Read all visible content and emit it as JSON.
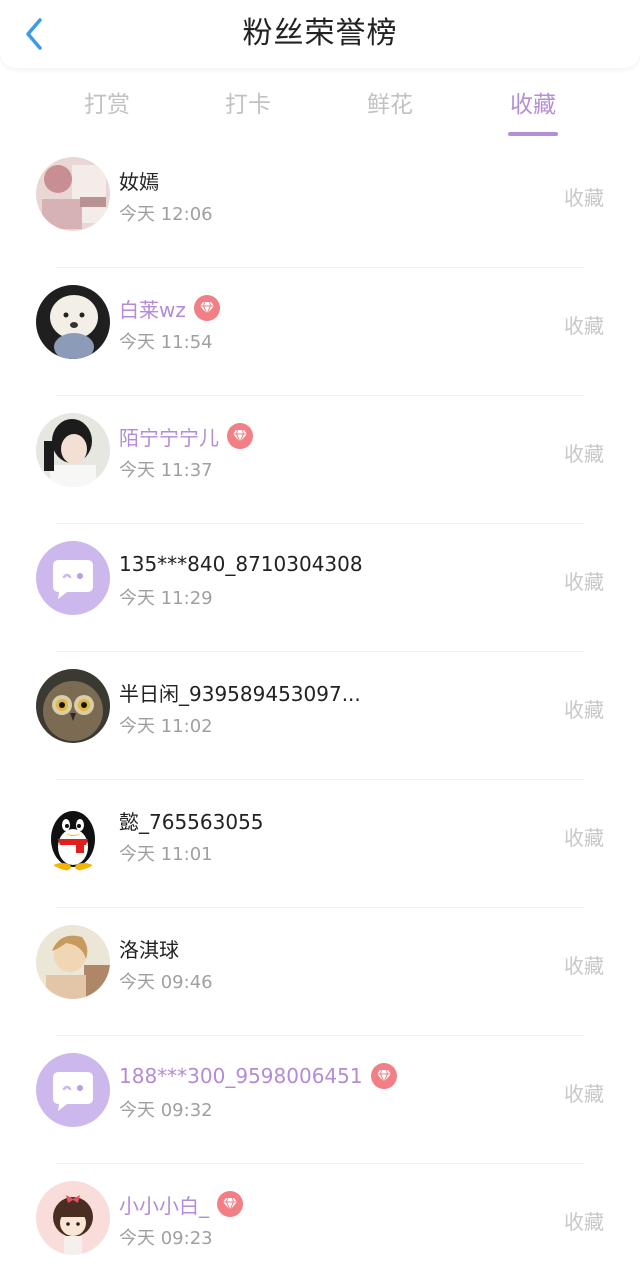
{
  "header": {
    "title": "粉丝荣誉榜",
    "back_icon": "chevron-left-icon"
  },
  "tabs": [
    {
      "label": "打赏",
      "active": false
    },
    {
      "label": "打卡",
      "active": false
    },
    {
      "label": "鲜花",
      "active": false
    },
    {
      "label": "收藏",
      "active": true
    }
  ],
  "colors": {
    "accent": "#b58fd6",
    "vip_name": "#b38bd6",
    "vip_badge": "#f17f85",
    "back_icon": "#3a9bea"
  },
  "fans": [
    {
      "name": "奻嫣",
      "time": "今天 12:06",
      "action": "收藏",
      "vip": false,
      "avatar": "photo-pink"
    },
    {
      "name": "白莱wz",
      "time": "今天 11:54",
      "action": "收藏",
      "vip": true,
      "avatar": "photo-dog"
    },
    {
      "name": "陌宁宁宁儿",
      "time": "今天 11:37",
      "action": "收藏",
      "vip": true,
      "avatar": "photo-girl"
    },
    {
      "name": "135***840_8710304308",
      "time": "今天 11:29",
      "action": "收藏",
      "vip": false,
      "avatar": "default-chat-bubble"
    },
    {
      "name": "半日闲_939589453097...",
      "time": "今天 11:02",
      "action": "收藏",
      "vip": false,
      "avatar": "photo-owl"
    },
    {
      "name": "懿_765563055",
      "time": "今天 11:01",
      "action": "收藏",
      "vip": false,
      "avatar": "penguin"
    },
    {
      "name": "洛淇球",
      "time": "今天 09:46",
      "action": "收藏",
      "vip": false,
      "avatar": "photo-doll"
    },
    {
      "name": "188***300_9598006451",
      "time": "今天 09:32",
      "action": "收藏",
      "vip": true,
      "avatar": "default-chat-bubble"
    },
    {
      "name": "小小小白_",
      "time": "今天 09:23",
      "action": "收藏",
      "vip": true,
      "avatar": "cartoon-girl"
    }
  ]
}
